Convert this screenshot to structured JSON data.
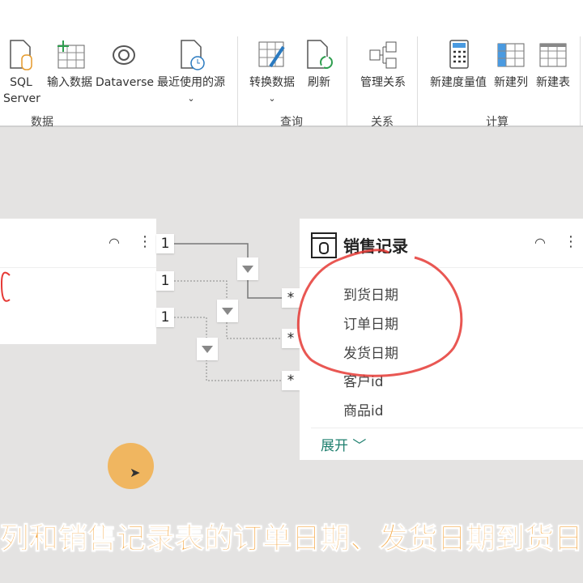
{
  "ribbon": {
    "buttons": [
      {
        "label": "SQL Server",
        "l1": "SQL",
        "l2": "Server"
      },
      {
        "label": "输入数据"
      },
      {
        "label": "Dataverse"
      },
      {
        "label": "最近使用的源"
      },
      {
        "label": "转换数据"
      },
      {
        "label": "刷新"
      },
      {
        "label": "管理关系"
      },
      {
        "label": "新建度量值"
      },
      {
        "label": "新建列"
      },
      {
        "label": "新建表"
      }
    ],
    "groups": [
      "数据",
      "查询",
      "关系",
      "计算"
    ]
  },
  "diagram": {
    "left_markers": [
      "1",
      "1",
      "1"
    ],
    "right_markers": [
      "*",
      "*",
      "*"
    ],
    "table": {
      "title": "销售记录",
      "fields": [
        "到货日期",
        "订单日期",
        "发货日期",
        "客户id",
        "商品id"
      ],
      "expand_label": "展开"
    }
  },
  "subtitle": "列和销售记录表的订单日期、发货日期到货日",
  "colors": {
    "accent": "#1e7f6e",
    "subtitle": "#f4a640",
    "annotation": "#e53935"
  }
}
